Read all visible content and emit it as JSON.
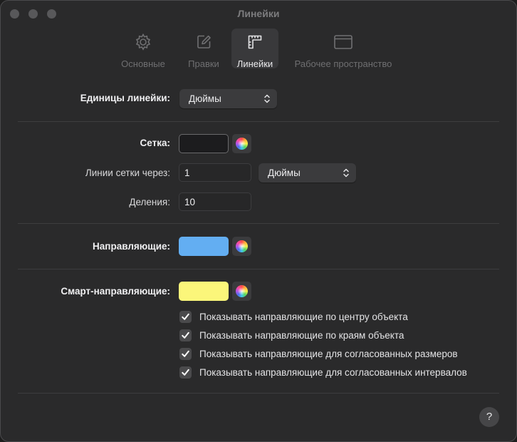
{
  "window": {
    "title": "Линейки"
  },
  "tabs": [
    {
      "label": "Основные",
      "icon": "gear-icon"
    },
    {
      "label": "Правки",
      "icon": "edit-icon"
    },
    {
      "label": "Линейки",
      "icon": "ruler-icon",
      "active": true
    },
    {
      "label": "Рабочее пространство",
      "icon": "window-icon"
    }
  ],
  "ruler_units": {
    "label": "Единицы линейки:",
    "value": "Дюймы"
  },
  "grid": {
    "label": "Сетка:",
    "color": "#1c1c1e",
    "lines_every_label": "Линии сетки через:",
    "lines_every_value": "1",
    "lines_every_unit": "Дюймы",
    "divisions_label": "Деления:",
    "divisions_value": "10"
  },
  "guides": {
    "label": "Направляющие:",
    "color": "#63aef2"
  },
  "smart_guides": {
    "label": "Смарт-направляющие:",
    "color": "#fbf67a",
    "options": [
      {
        "label": "Показывать направляющие по центру объекта",
        "checked": true
      },
      {
        "label": "Показывать направляющие по краям объекта",
        "checked": true
      },
      {
        "label": "Показывать направляющие для согласованных размеров",
        "checked": true
      },
      {
        "label": "Показывать направляющие для согласованных интервалов",
        "checked": true
      }
    ]
  },
  "help": {
    "label": "?"
  }
}
